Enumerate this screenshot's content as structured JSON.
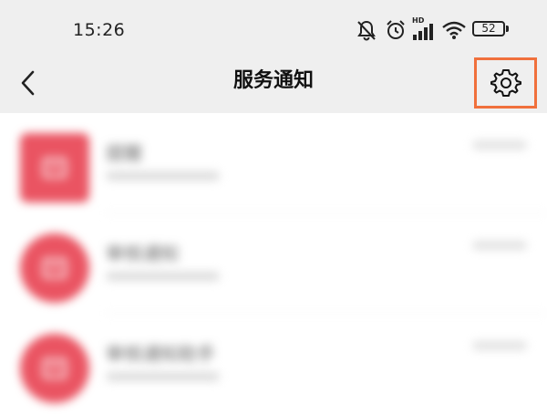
{
  "status_bar": {
    "time": "15:26",
    "network_label": "HD",
    "battery_level": "52",
    "icons": [
      "mute-bell-icon",
      "alarm-icon",
      "hd-signal-icon",
      "wifi-icon",
      "battery-icon"
    ]
  },
  "header": {
    "title": "服务通知",
    "back_icon": "chevron-left-icon",
    "settings_icon": "gear-icon",
    "highlight_color": "#f0703c"
  },
  "notifications": [
    {
      "title": "提醒",
      "avatar_shape": "square",
      "avatar_color": "#ea5462"
    },
    {
      "title": "审核通知",
      "avatar_shape": "round",
      "avatar_color": "#ea5462"
    },
    {
      "title": "审核通知助手",
      "avatar_shape": "round",
      "avatar_color": "#ea5462"
    }
  ]
}
